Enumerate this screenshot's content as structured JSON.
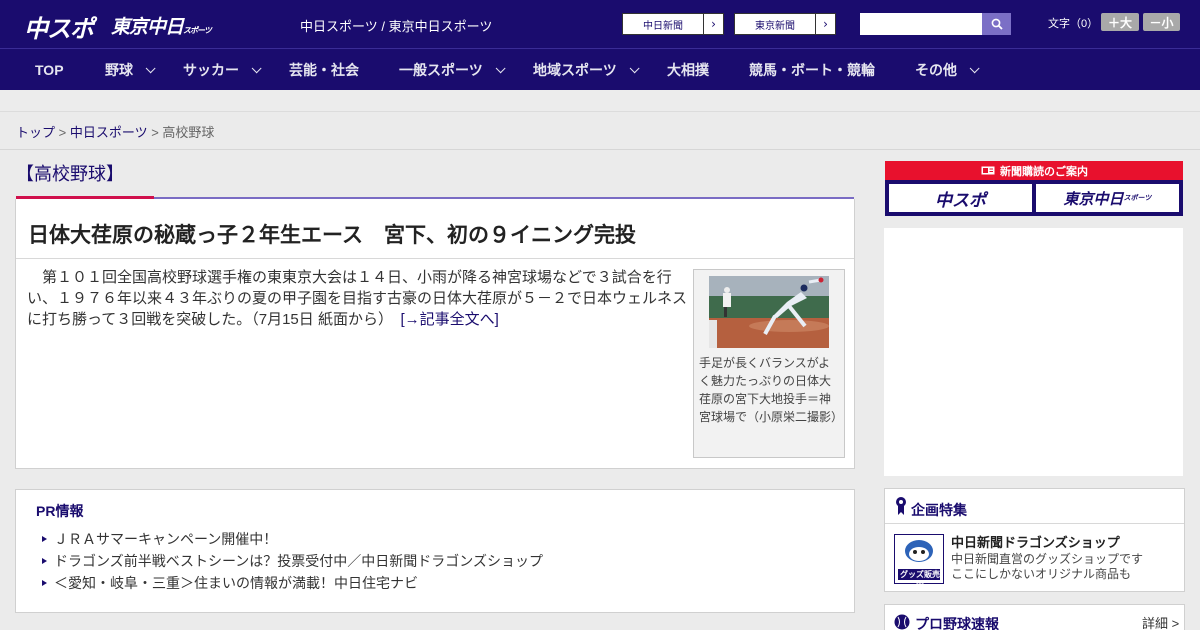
{
  "header": {
    "logo_chuspo": "中スポ",
    "logo_tokyo": "東京中日",
    "logo_tokyo_sub": "スポーツ",
    "site_title": "中日スポーツ / 東京中日スポーツ",
    "ext_links": [
      {
        "label": "中日新聞"
      },
      {
        "label": "東京新聞"
      }
    ],
    "search": {
      "placeholder": "",
      "value": ""
    },
    "font_size_label": "文字（0）",
    "font_larger": "＋大",
    "font_smaller": "－小"
  },
  "nav": {
    "items": [
      {
        "label": "TOP"
      },
      {
        "label": "野球"
      },
      {
        "label": "サッカー"
      },
      {
        "label": "芸能・社会"
      },
      {
        "label": "一般スポーツ"
      },
      {
        "label": "地域スポーツ"
      },
      {
        "label": "大相撲"
      },
      {
        "label": "競馬・ボート・競輪"
      },
      {
        "label": "その他"
      }
    ]
  },
  "breadcrumb": {
    "home": "トップ",
    "sep": " > ",
    "section": "中日スポーツ",
    "current": "高校野球"
  },
  "section": {
    "title": "【高校野球】"
  },
  "article": {
    "headline": "日体大荏原の秘蔵っ子２年生エース　宮下、初の９イニング完投",
    "lead": "　第１０１回全国高校野球選手権の東東京大会は１４日、小雨が降る神宮球場などで３試合を行い、１９７６年以来４３年ぶりの夏の甲子園を目指す古豪の日体大荏原が５－２で日本ウェルネスに打ち勝って３回戦を突破した。（7月15日 紙面から）　",
    "more_link": "[→記事全文へ]",
    "photo_caption": "手足が長くバランスがよく魅力たっぷりの日体大荏原の宮下大地投手＝神宮球場で（小原栄二撮影）"
  },
  "pr": {
    "title": "PR情報",
    "items": [
      "ＪＲＡサマーキャンペーン開催中！",
      "ドラゴンズ前半戦ベストシーンは？投票受付中／中日新聞ドラゴンズショップ",
      "＜愛知・岐阜・三重＞住まいの情報が満載！中日住宅ナビ"
    ]
  },
  "sidebar": {
    "subscription": {
      "title": "新聞購読のご案内",
      "chuspo": "中スポ",
      "tokyo": "東京中日",
      "tokyo_sub": "スポーツ"
    },
    "feature": {
      "title": "企画特集",
      "item_title": "中日新聞ドラゴンズショップ",
      "item_desc_1": "中日新聞直営のグッズショップです",
      "item_desc_2": "ここにしかないオリジナル商品も",
      "thumb_text": "グッズ販売中"
    },
    "score": {
      "title": "プロ野球速報",
      "detail": "詳細 >"
    }
  },
  "colors": {
    "brand_navy": "#1a0c6e",
    "accent_red": "#d0104c",
    "accent_purple": "#7a6cc4"
  }
}
